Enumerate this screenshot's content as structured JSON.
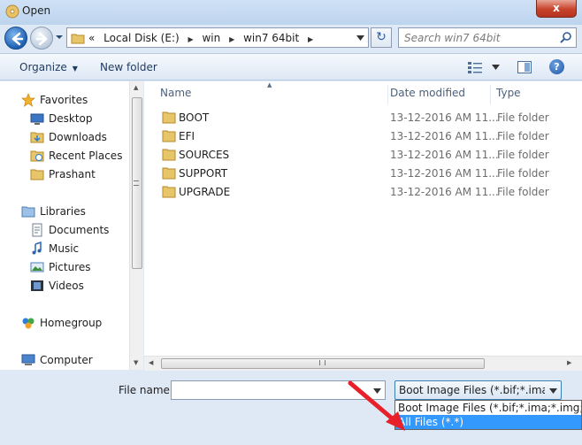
{
  "window": {
    "title": "Open",
    "close_label": "x"
  },
  "nav": {
    "overflow_chevron": "«",
    "breadcrumb": [
      "Local Disk  (E:)",
      "win",
      "win7 64bit"
    ],
    "search_placeholder": "Search win7 64bit",
    "refresh_glyph": "↻"
  },
  "toolbar": {
    "organize": "Organize",
    "new_folder": "New folder",
    "help_glyph": "?"
  },
  "sidebar": {
    "favorites": {
      "label": "Favorites",
      "items": [
        "Desktop",
        "Downloads",
        "Recent Places",
        "Prashant"
      ]
    },
    "libraries": {
      "label": "Libraries",
      "items": [
        "Documents",
        "Music",
        "Pictures",
        "Videos"
      ]
    },
    "homegroup": "Homegroup",
    "computer": "Computer"
  },
  "columns": {
    "name": "Name",
    "date_modified": "Date modified",
    "type": "Type"
  },
  "files": [
    {
      "name": "BOOT",
      "date": "13-12-2016 AM 11...",
      "type": "File folder"
    },
    {
      "name": "EFI",
      "date": "13-12-2016 AM 11...",
      "type": "File folder"
    },
    {
      "name": "SOURCES",
      "date": "13-12-2016 AM 11...",
      "type": "File folder"
    },
    {
      "name": "SUPPORT",
      "date": "13-12-2016 AM 11...",
      "type": "File folder"
    },
    {
      "name": "UPGRADE",
      "date": "13-12-2016 AM 11...",
      "type": "File folder"
    }
  ],
  "bottom": {
    "file_name_label": "File name:",
    "file_name_value": "",
    "filter_selected": "Boot Image Files (*.bif;*.ima;*.img;*.flp)",
    "filter_options": [
      "Boot Image Files (*.bif;*.ima;*.img;*.flp)",
      "All Files (*.*)"
    ]
  },
  "colors": {
    "highlight": "#3399ff",
    "annotation_arrow": "#e8202a",
    "chrome": "#dfe9f5"
  },
  "icons": [
    "app-disc-icon",
    "back-arrow-icon",
    "forward-arrow-icon",
    "folder-icon",
    "search-icon",
    "views-icon",
    "preview-pane-icon",
    "help-icon",
    "star-icon",
    "desktop-icon",
    "library-icon",
    "homegroup-icon",
    "computer-icon",
    "red-arrow-icon"
  ]
}
